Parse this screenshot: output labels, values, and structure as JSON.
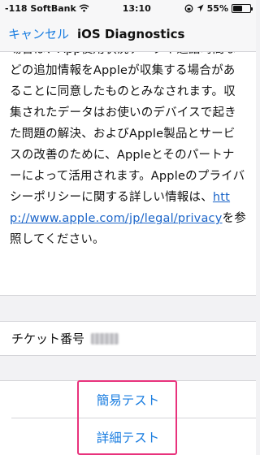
{
  "status_bar": {
    "carrier": "-118 SoftBank",
    "time": "13:10",
    "battery": "55%",
    "battery_level": 0.55
  },
  "nav": {
    "cancel_label": "キャンセル",
    "title": "iOS Diagnostics"
  },
  "content": {
    "text": "場合は、App使用状況データや通話時間などの追加情報をAppleが収集する場合があることに同意したものとみなされます。収集されたデータはお使いのデバイスで起きた問題の解決、およびApple製品とサービスの改善のために、Appleとそのパートナーによって活用されます。Appleのプライバシーポリシーに関する詳しい情報は、",
    "link": "http://www.apple.com/jp/legal/privacy",
    "suffix": "を参照してください。"
  },
  "ticket": {
    "label": "チケット番号"
  },
  "actions": {
    "quick_test": "簡易テスト",
    "detailed_test": "詳細テスト"
  },
  "colors": {
    "accent": "#1a7de0",
    "highlight": "#e8327c"
  }
}
